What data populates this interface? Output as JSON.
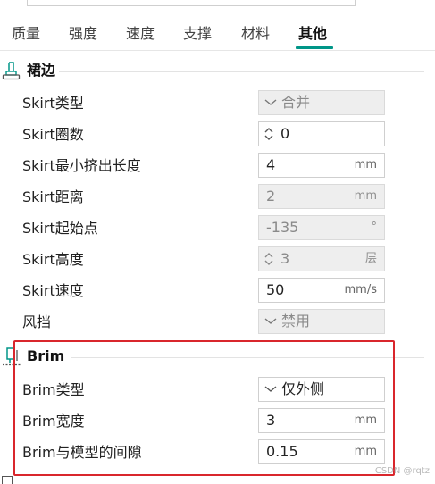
{
  "tabs": [
    {
      "label": "质量",
      "active": false
    },
    {
      "label": "强度",
      "active": false
    },
    {
      "label": "速度",
      "active": false
    },
    {
      "label": "支撑",
      "active": false
    },
    {
      "label": "材料",
      "active": false
    },
    {
      "label": "其他",
      "active": true
    }
  ],
  "accent_color": "#009688",
  "highlight_color": "#d9262c",
  "skirt": {
    "title": "裙边",
    "icon": "skirt-icon",
    "rows": [
      {
        "label": "Skirt类型",
        "value": "合并",
        "unit": "",
        "control": "dropdown",
        "disabled": true
      },
      {
        "label": "Skirt圈数",
        "value": "0",
        "unit": "",
        "control": "spinbox",
        "disabled": false
      },
      {
        "label": "Skirt最小挤出长度",
        "value": "4",
        "unit": "mm",
        "control": "text",
        "disabled": false
      },
      {
        "label": "Skirt距离",
        "value": "2",
        "unit": "mm",
        "control": "text",
        "disabled": true
      },
      {
        "label": "Skirt起始点",
        "value": "-135",
        "unit": "°",
        "control": "text",
        "disabled": true
      },
      {
        "label": "Skirt高度",
        "value": "3",
        "unit": "层",
        "control": "spinbox",
        "disabled": true
      },
      {
        "label": "Skirt速度",
        "value": "50",
        "unit": "mm/s",
        "control": "text",
        "disabled": false
      },
      {
        "label": "风挡",
        "value": "禁用",
        "unit": "",
        "control": "dropdown",
        "disabled": true
      }
    ]
  },
  "brim": {
    "title": "Brim",
    "icon": "brim-icon",
    "rows": [
      {
        "label": "Brim类型",
        "value": "仅外侧",
        "unit": "",
        "control": "dropdown",
        "disabled": false
      },
      {
        "label": "Brim宽度",
        "value": "3",
        "unit": "mm",
        "control": "text",
        "disabled": false
      },
      {
        "label": "Brim与模型的间隙",
        "value": "0.15",
        "unit": "mm",
        "control": "text",
        "disabled": false
      }
    ]
  },
  "watermark": "CSDN @rqtz"
}
